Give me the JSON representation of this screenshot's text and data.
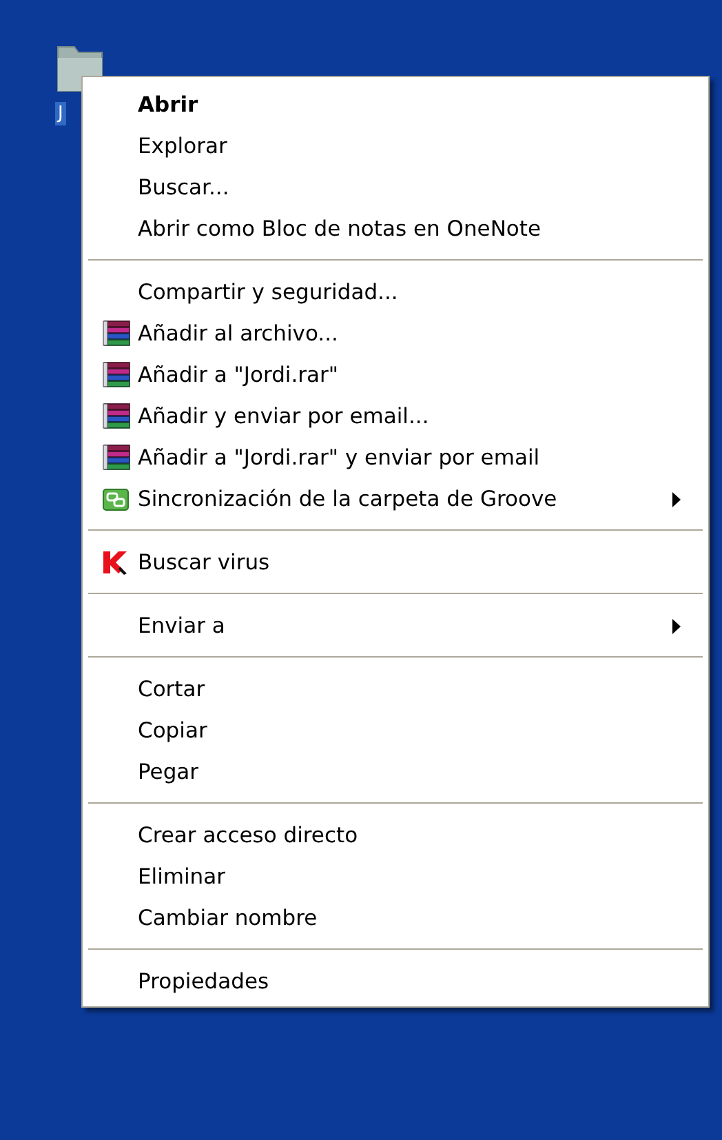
{
  "desktop": {
    "icons": [
      {
        "label": "J",
        "selected": true
      }
    ]
  },
  "context_menu": {
    "groups": [
      [
        {
          "label": "Abrir",
          "kind": "plain",
          "default": true,
          "submenu": false
        },
        {
          "label": "Explorar",
          "kind": "plain",
          "default": false,
          "submenu": false
        },
        {
          "label": "Buscar...",
          "kind": "plain",
          "default": false,
          "submenu": false
        },
        {
          "label": "Abrir como Bloc de notas en OneNote",
          "kind": "plain",
          "default": false,
          "submenu": false
        }
      ],
      [
        {
          "label": "Compartir y seguridad...",
          "kind": "plain",
          "default": false,
          "submenu": false
        },
        {
          "label": "Añadir al archivo...",
          "kind": "archive",
          "default": false,
          "submenu": false
        },
        {
          "label": "Añadir a \"Jordi.rar\"",
          "kind": "archive",
          "default": false,
          "submenu": false
        },
        {
          "label": "Añadir y enviar por email...",
          "kind": "archive",
          "default": false,
          "submenu": false
        },
        {
          "label": "Añadir a \"Jordi.rar\" y enviar por email",
          "kind": "archive",
          "default": false,
          "submenu": false
        },
        {
          "label": "Sincronización de la carpeta de Groove",
          "kind": "sync",
          "default": false,
          "submenu": true
        }
      ],
      [
        {
          "label": "Buscar virus",
          "kind": "antivirus",
          "default": false,
          "submenu": false
        }
      ],
      [
        {
          "label": "Enviar a",
          "kind": "plain",
          "default": false,
          "submenu": true
        }
      ],
      [
        {
          "label": "Cortar",
          "kind": "plain",
          "default": false,
          "submenu": false
        },
        {
          "label": "Copiar",
          "kind": "plain",
          "default": false,
          "submenu": false
        },
        {
          "label": "Pegar",
          "kind": "plain",
          "default": false,
          "submenu": false
        }
      ],
      [
        {
          "label": "Crear acceso directo",
          "kind": "plain",
          "default": false,
          "submenu": false
        },
        {
          "label": "Eliminar",
          "kind": "plain",
          "default": false,
          "submenu": false
        },
        {
          "label": "Cambiar nombre",
          "kind": "plain",
          "default": false,
          "submenu": false
        }
      ],
      [
        {
          "label": "Propiedades",
          "kind": "plain",
          "default": false,
          "submenu": false
        }
      ]
    ]
  }
}
